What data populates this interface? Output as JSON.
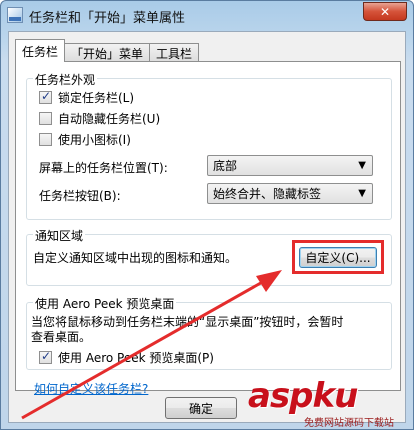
{
  "window": {
    "title": "任务栏和「开始」菜单属性",
    "close_glyph": "✕"
  },
  "tabs": [
    {
      "label": "任务栏",
      "active": true
    },
    {
      "label": "「开始」菜单",
      "active": false
    },
    {
      "label": "工具栏",
      "active": false
    }
  ],
  "appearance": {
    "group_title": "任务栏外观",
    "checkboxes": [
      {
        "label": "锁定任务栏(L)",
        "checked": true
      },
      {
        "label": "自动隐藏任务栏(U)",
        "checked": false
      },
      {
        "label": "使用小图标(I)",
        "checked": false
      }
    ],
    "position_label": "屏幕上的任务栏位置(T):",
    "position_value": "底部",
    "buttons_label": "任务栏按钮(B):",
    "buttons_value": "始终合并、隐藏标签"
  },
  "notification": {
    "group_title": "通知区域",
    "description": "自定义通知区域中出现的图标和通知。",
    "customize_label": "自定义(C)..."
  },
  "aero_peek": {
    "group_title": "使用 Aero Peek 预览桌面",
    "description_line1": "当您将鼠标移动到任务栏末端的“显示桌面”按钮时，会暂时",
    "description_line2": "查看桌面。",
    "checkbox_label": "使用 Aero Peek 预览桌面(P)",
    "checked": true
  },
  "help_link": "如何自定义该任务栏?",
  "footer": {
    "ok_label": "确定"
  },
  "watermark": {
    "logo_asp": "asp",
    "logo_ku": "ku",
    "sub": "免费网站源码下载站"
  },
  "colors": {
    "highlight": "#e42c2c",
    "link": "#0066cc",
    "close": "#c4381f"
  }
}
